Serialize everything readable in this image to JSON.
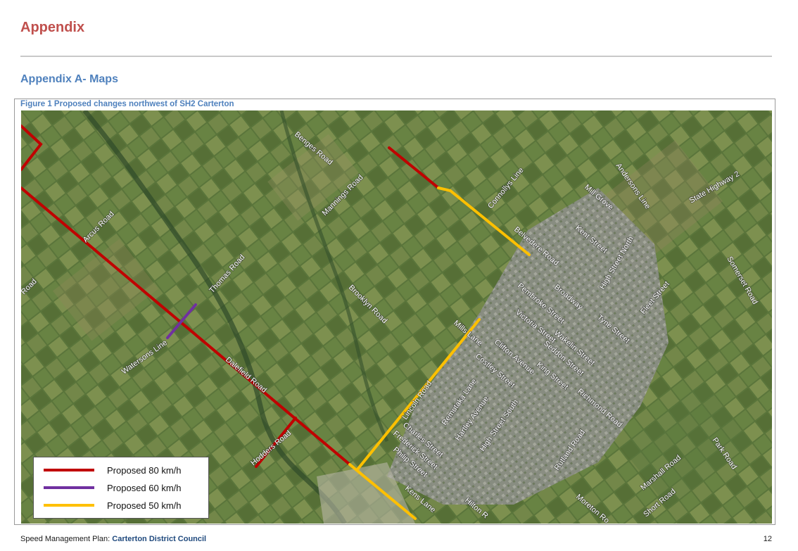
{
  "page": {
    "heading": "Appendix",
    "subheading": "Appendix A- Maps",
    "figure_caption": "Figure 1 Proposed changes northwest of SH2 Carterton"
  },
  "legend": {
    "items": [
      {
        "label": "Proposed 80 km/h",
        "color": "#c00000"
      },
      {
        "label": "Proposed 60 km/h",
        "color": "#7030a0"
      },
      {
        "label": "Proposed 50 km/h",
        "color": "#ffc000"
      }
    ]
  },
  "map": {
    "road_labels": [
      "Benges Road",
      "Mannings Road",
      "Arcus Road",
      "Road",
      "Thomas Road",
      "Brooklyn Road",
      "Watersons Line",
      "Dalefield Road",
      "Hodders Road",
      "Connollys Line",
      "Belvedere Road",
      "Mill Grove",
      "Andersons Line",
      "State Highway 2",
      "Kent Street",
      "High Street North",
      "Pembroke Street",
      "Broadway",
      "Fleet Street",
      "Somerset Road",
      "Victoria Street",
      "Tyne Street",
      "Wakelin Street",
      "Seddon Street",
      "Mills Lane",
      "Clifton Avenue",
      "Costley Street",
      "King Street",
      "Lincoln Road",
      "Remutaka Lane",
      "Hartley Avenue",
      "Richmond Road",
      "High Street South",
      "Charles Street",
      "Frederick Street",
      "Philip Street",
      "Rutland Road",
      "Marshall Road",
      "Park Road",
      "Kens Lane",
      "Hilton R",
      "Moreton Ro",
      "Short Road"
    ]
  },
  "footer": {
    "prefix": "Speed Management Plan: ",
    "organisation": "Carterton District Council",
    "page_number": "12"
  }
}
